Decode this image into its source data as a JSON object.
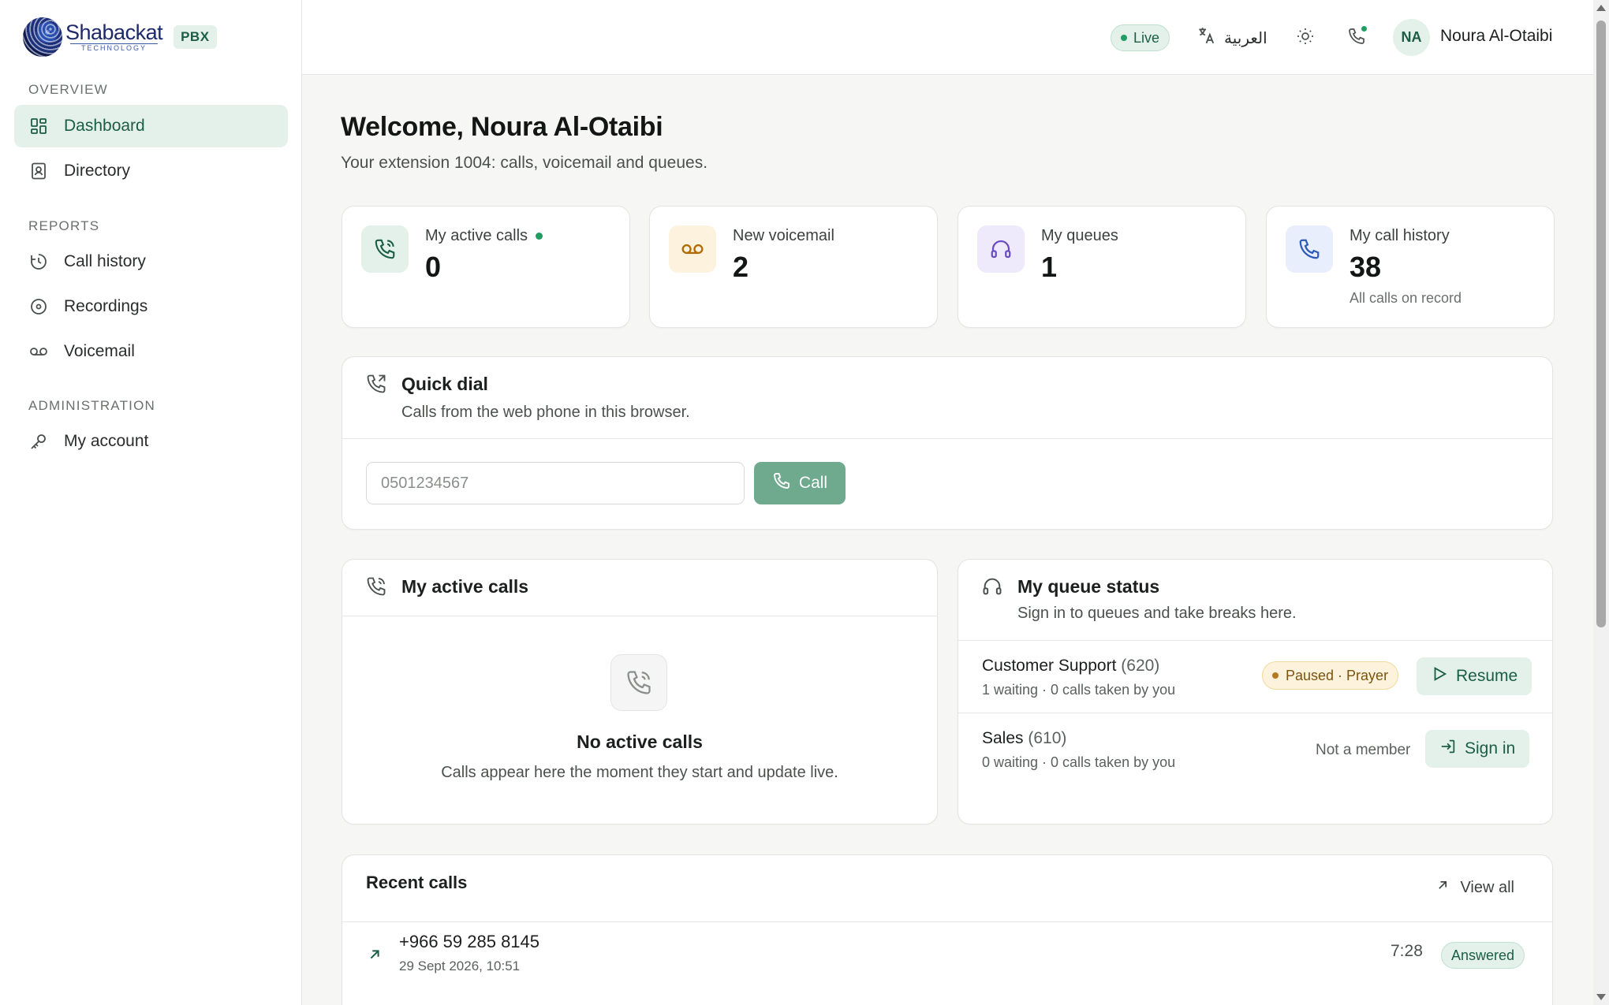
{
  "brand": {
    "logo_name": "Shabackat",
    "logo_sub": "TECHNOLOGY",
    "badge": "PBX"
  },
  "sidebar": {
    "sections": [
      {
        "label": "OVERVIEW"
      },
      {
        "label": "REPORTS"
      },
      {
        "label": "ADMINISTRATION"
      }
    ],
    "items": [
      {
        "label": "Dashboard",
        "icon": "dashboard-grid-icon",
        "active": true
      },
      {
        "label": "Directory",
        "icon": "contact-book-icon",
        "active": false
      },
      {
        "label": "Call history",
        "icon": "clock-history-icon",
        "active": false
      },
      {
        "label": "Recordings",
        "icon": "disc-icon",
        "active": false
      },
      {
        "label": "Voicemail",
        "icon": "voicemail-icon",
        "active": false
      },
      {
        "label": "My account",
        "icon": "key-icon",
        "active": false
      }
    ]
  },
  "topbar": {
    "live_label": "Live",
    "language_label": "العربية",
    "avatar_initials": "NA",
    "user_name": "Noura Al-Otaibi"
  },
  "page": {
    "title": "Welcome, Noura Al-Otaibi",
    "subtitle": "Your extension 1004: calls, voicemail and queues."
  },
  "stats": [
    {
      "label": "My active calls",
      "value": "0",
      "note": "",
      "icon": "phone-ringing-icon",
      "color": "#1b5e43",
      "bg": "#e3f1ea",
      "live": true
    },
    {
      "label": "New voicemail",
      "value": "2",
      "note": "",
      "icon": "voicemail-icon",
      "color": "#b26b00",
      "bg": "#fdf2dd",
      "live": false
    },
    {
      "label": "My queues",
      "value": "1",
      "note": "",
      "icon": "headset-icon",
      "color": "#6a4cc4",
      "bg": "#efeafb",
      "live": false
    },
    {
      "label": "My call history",
      "value": "38",
      "note": "All calls on record",
      "icon": "phone-icon",
      "color": "#2e5bb8",
      "bg": "#e8eefb",
      "live": false
    }
  ],
  "quick_dial": {
    "title": "Quick dial",
    "description": "Calls from the web phone in this browser.",
    "input_placeholder": "0501234567",
    "input_value": "",
    "call_label": "Call"
  },
  "active_calls": {
    "title": "My active calls",
    "empty_title": "No active calls",
    "empty_desc": "Calls appear here the moment they start and update live."
  },
  "queue_status": {
    "title": "My queue status",
    "description": "Sign in to queues and take breaks here.",
    "queues": [
      {
        "name": "Customer Support",
        "ext": "(620)",
        "meta": "1 waiting · 0 calls taken by you",
        "status": "Paused · Prayer",
        "action": "Resume"
      },
      {
        "name": "Sales",
        "ext": "(610)",
        "meta": "0 waiting · 0 calls taken by you",
        "status": "Not a member",
        "action": "Sign in"
      }
    ]
  },
  "recent_calls": {
    "title": "Recent calls",
    "view_all_label": "View all",
    "calls": [
      {
        "number": "+966 59 285 8145",
        "date": "29 Sept 2026, 10:51",
        "duration": "7:28",
        "status": "Answered"
      }
    ]
  },
  "colors": {
    "accent": "#1b5e43",
    "accent_soft": "#e3f1ea",
    "call_button": "#6fa98e",
    "live_dot": "#1f9d63"
  }
}
